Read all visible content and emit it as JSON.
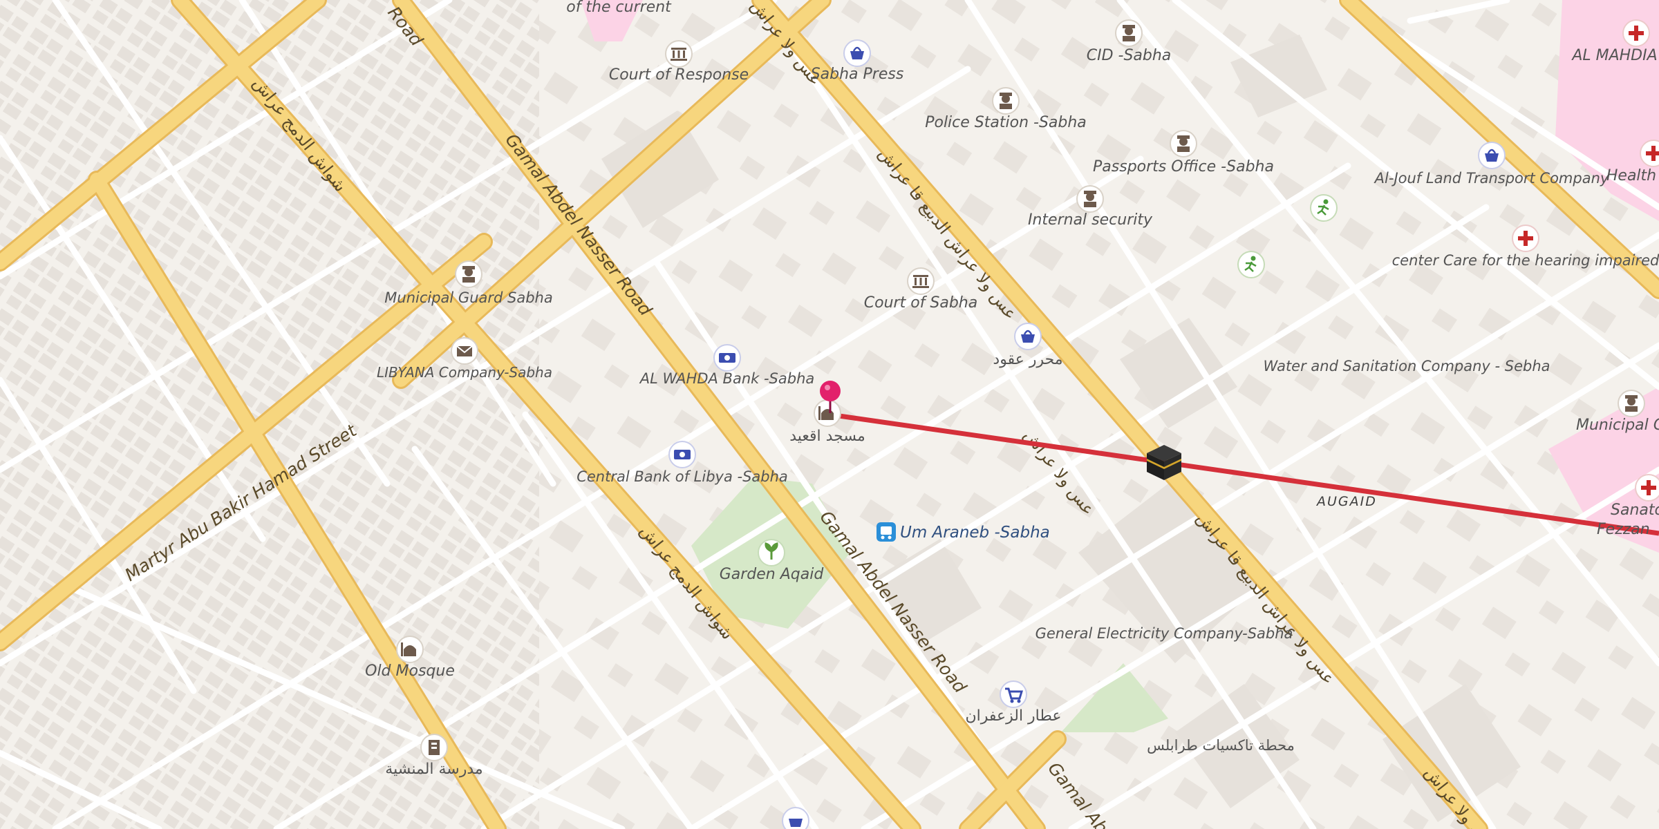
{
  "map": {
    "colors": {
      "background": "#f4f1ec",
      "building": "#e6e1db",
      "minor_road": "#ffffff",
      "major_road": "#f7d67e",
      "park": "#d6e8c8",
      "medical_area": "#fcd3e6",
      "route": "#d5303a",
      "pin": "#e2216b"
    },
    "roads": [
      {
        "label": "Gamal Abdel Nasser Road"
      },
      {
        "label": "Gamal Abdel Nasser Road"
      },
      {
        "label": "Martyr Abu Bakir Hamad Street"
      },
      {
        "label": "Road"
      },
      {
        "label": "Gamal Abd"
      }
    ],
    "arabic_road_labels": [
      {
        "text": "شواش الدمج عراش"
      },
      {
        "text": "شواش الدمج عراش"
      },
      {
        "text": "عس ولا عراش الدبيع قا عراش"
      },
      {
        "text": "عس ولا عراش الدبيع قا عراش"
      },
      {
        "text": "عس ولا عراش"
      },
      {
        "text": "عس ولا عراش"
      },
      {
        "text": "عس ولا عراش"
      }
    ],
    "pois": [
      {
        "label": "of the current",
        "icon": "none"
      },
      {
        "label": "Court of Response",
        "icon": "courthouse-icon"
      },
      {
        "label": "Sabha Press",
        "icon": "shop-icon"
      },
      {
        "label": "CID -Sabha",
        "icon": "police-icon"
      },
      {
        "label": "AL MAHDIA",
        "icon": "hospital-icon"
      },
      {
        "label": "Police Station -Sabha",
        "icon": "police-icon"
      },
      {
        "label": "Passports Office -Sabha",
        "icon": "police-icon"
      },
      {
        "label": "Al-Jouf Land Transport Company",
        "icon": "shop-icon"
      },
      {
        "label": "Health",
        "icon": "hospital-icon"
      },
      {
        "label": "Internal security",
        "icon": "police-icon"
      },
      {
        "label": "center Care for the hearing impaired",
        "icon": "hospital-icon"
      },
      {
        "label": "Court of Sabha",
        "icon": "courthouse-icon"
      },
      {
        "label": "Municipal Guard Sabha",
        "icon": "police-icon"
      },
      {
        "label": "محرر عقود",
        "icon": "shop-icon"
      },
      {
        "label": "Water and Sanitation Company - Sebha",
        "icon": "none"
      },
      {
        "label": "Municipal G",
        "icon": "police-icon"
      },
      {
        "label": "LIBYANA Company-Sabha",
        "icon": "post-icon"
      },
      {
        "label": "AL WAHDA Bank -Sabha",
        "icon": "bank-icon"
      },
      {
        "label": "مسجد اقعيد",
        "icon": "mosque-icon"
      },
      {
        "label": "Central Bank of Libya -Sabha",
        "icon": "bank-icon"
      },
      {
        "label": "Sanato",
        "icon": "hospital-icon"
      },
      {
        "label": "Fezzan",
        "icon": "none"
      },
      {
        "label": "Um Araneb -Sabha",
        "icon": "bus-icon"
      },
      {
        "label": "Garden Aqaid",
        "icon": "garden-icon"
      },
      {
        "label": "General Electricity Company-Sabha",
        "icon": "none"
      },
      {
        "label": "Old Mosque",
        "icon": "mosque-icon"
      },
      {
        "label": "عطار الزعفران",
        "icon": "cart-icon"
      },
      {
        "label": "محطة تاكسيات طرابلس",
        "icon": "none"
      },
      {
        "label": "مدرسة المنشية",
        "icon": "school-icon"
      }
    ],
    "area_label": "AUGAID"
  }
}
